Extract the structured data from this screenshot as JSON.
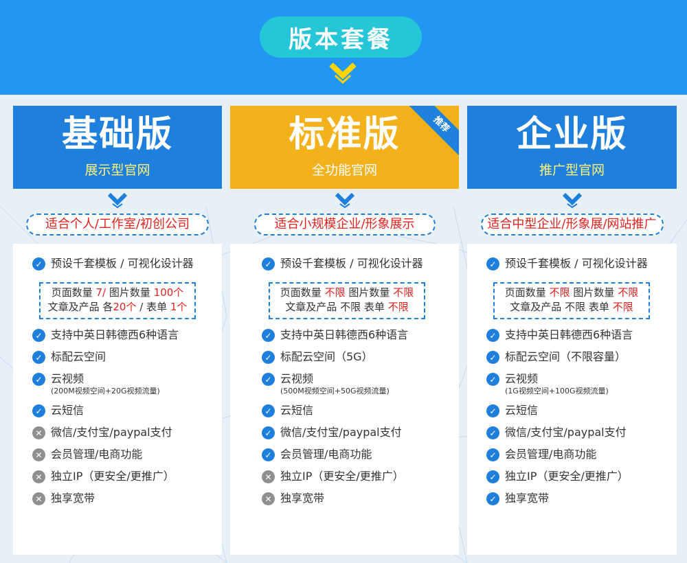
{
  "header": {
    "title": "版本套餐"
  },
  "colors": {
    "band": "#2196f3",
    "pill": "#25c6d8",
    "blue": "#1e7fdc",
    "yellow": "#f3b21b",
    "red": "#e3221e",
    "chevron": "#ffd400"
  },
  "plans": [
    {
      "name": "基础版",
      "subtitle": "展示型官网",
      "fit": "适合个人/工作室/初创公司",
      "quota": {
        "pages_label": "页面数量",
        "pages_value": "7/",
        "images_label": "图片数量",
        "images_value": "100个",
        "articles_label": "文章及产品",
        "articles_value_prefix": "各",
        "articles_value": "20个",
        "forms_label": "/  表单",
        "forms_value": "1个"
      },
      "features": [
        {
          "label": "预设千套模板 / 可视化设计器",
          "included": true
        },
        {
          "label": "支持中英日韩德西6种语言",
          "included": true
        },
        {
          "label": "标配云空间",
          "included": true
        },
        {
          "label": "云视频",
          "note": "(200M视频空间+20G视频流量)",
          "included": true
        },
        {
          "label": "云短信",
          "included": true
        },
        {
          "label": "微信/支付宝/paypal支付",
          "included": false
        },
        {
          "label": "会员管理/电商功能",
          "included": false
        },
        {
          "label": "独立IP（更安全/更推广）",
          "included": false
        },
        {
          "label": "独享宽带",
          "included": false
        }
      ]
    },
    {
      "name": "标准版",
      "subtitle": "全功能官网",
      "badge": "推荐",
      "fit": "适合小规模企业/形象展示",
      "quota": {
        "pages_label": "页面数量",
        "pages_value": "不限",
        "images_label": "图片数量",
        "images_value": "不限",
        "articles_label": "文章及产品",
        "articles_value": "不限",
        "forms_label": "表单",
        "forms_value": "不限"
      },
      "features": [
        {
          "label": "预设千套模板 / 可视化设计器",
          "included": true
        },
        {
          "label": "支持中英日韩德西6种语言",
          "included": true
        },
        {
          "label": "标配云空间（5G）",
          "included": true
        },
        {
          "label": "云视频",
          "note": "(500M视频空间+50G视频流量)",
          "included": true
        },
        {
          "label": "云短信",
          "included": true
        },
        {
          "label": "微信/支付宝/paypal支付",
          "included": true
        },
        {
          "label": "会员管理/电商功能",
          "included": true
        },
        {
          "label": "独立IP（更安全/更推广）",
          "included": false
        },
        {
          "label": "独享宽带",
          "included": false
        }
      ]
    },
    {
      "name": "企业版",
      "subtitle": "推广型官网",
      "fit": "适合中型企业/形象展/网站推广",
      "quota": {
        "pages_label": "页面数量",
        "pages_value": "不限",
        "images_label": "图片数量",
        "images_value": "不限",
        "articles_label": "文章及产品",
        "articles_value": "不限",
        "forms_label": "表单",
        "forms_value": "不限"
      },
      "features": [
        {
          "label": "预设千套模板 / 可视化设计器",
          "included": true
        },
        {
          "label": "支持中英日韩德西6种语言",
          "included": true
        },
        {
          "label": "标配云空间（不限容量）",
          "included": true
        },
        {
          "label": "云视频",
          "note": "(1G视频空间+100G视频流量)",
          "included": true
        },
        {
          "label": "云短信",
          "included": true
        },
        {
          "label": "微信/支付宝/paypal支付",
          "included": true
        },
        {
          "label": "会员管理/电商功能",
          "included": true
        },
        {
          "label": "独立IP（更安全/更推广）",
          "included": true
        },
        {
          "label": "独享宽带",
          "included": true
        }
      ]
    }
  ]
}
